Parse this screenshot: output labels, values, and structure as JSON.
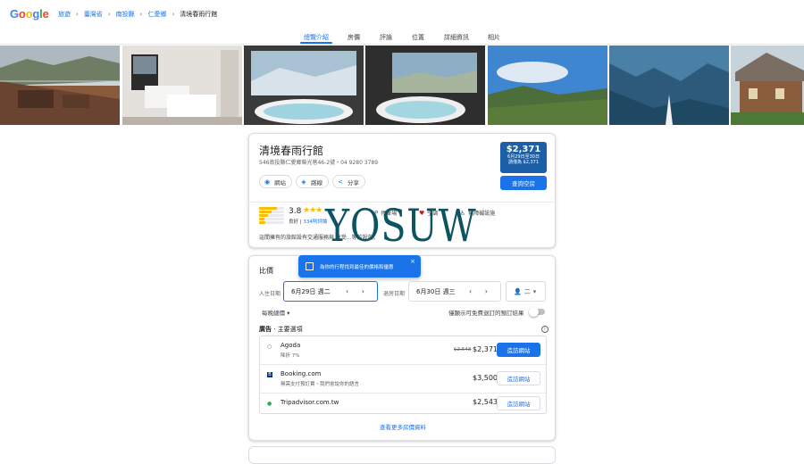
{
  "logo": {
    "text": "Google"
  },
  "breadcrumb": [
    "旅遊",
    "臺灣省",
    "南投縣",
    "仁愛鄉",
    "清境春雨行館"
  ],
  "tabs": [
    "總覽介紹",
    "房價",
    "評論",
    "位置",
    "詳細資訊",
    "相片"
  ],
  "photos": [
    "balcony-photo",
    "bedroom-photo",
    "bathtub-view-photo",
    "bathtub-window-photo",
    "mountain-photo",
    "valley-photo",
    "cabin-photo"
  ],
  "hotel": {
    "name": "清境春雨行館",
    "address": "546南投縣仁愛鄉榮光巷46-2號・04 9280 3789",
    "website_label": "網站",
    "directions_label": "路線",
    "share_label": "分享",
    "price": "$2,371",
    "price_dates": "6月29日至30日",
    "price_note": "請僅為 $2,371",
    "check_label": "查詢空房",
    "rating": "3.8",
    "stars": "★★★",
    "rating_word": "良好",
    "reviews_link": "334則評論",
    "amenity_1": "停車場",
    "amenity_2": "空調",
    "amenity_3": "無障礙設施",
    "description": "這間擁有的旅館設有交通服務與       享受...等的設施。"
  },
  "pricing": {
    "title": "比價",
    "tooltip": "為你的行程找到最佳的價格和優惠",
    "tooltip_close": "×",
    "checkin_label": "入住日期",
    "checkin_value": "6月29日 週二",
    "checkout_label": "退房日期",
    "checkout_value": "6月30日 週三",
    "date_arrows": "‹ ›",
    "guests": "二",
    "nightly_label": "每晚總價",
    "free_cancel_label": "僅顯示可免費退訂的預訂結果",
    "ad_label": "廣告",
    "featured_label": "主要選項",
    "offers": [
      {
        "name": "Agoda",
        "sub": "降折 7%",
        "strike": "$2,543",
        "price": "$2,371",
        "visit": "造訪網站"
      },
      {
        "name": "Booking.com",
        "sub": "無需支付預訂費・我們會說你的語言",
        "strike": "",
        "price": "$3,500",
        "visit": "造訪網站"
      },
      {
        "name": "Tripadvisor.com.tw",
        "sub": "",
        "strike": "",
        "price": "$2,543",
        "visit": "造訪網站"
      }
    ],
    "more_link": "查看更多房價資料"
  },
  "watermark": "YOSUW",
  "colors": {
    "accent": "#1a73e8",
    "price_box": "#1a5fa8",
    "star": "#fbbc04"
  }
}
